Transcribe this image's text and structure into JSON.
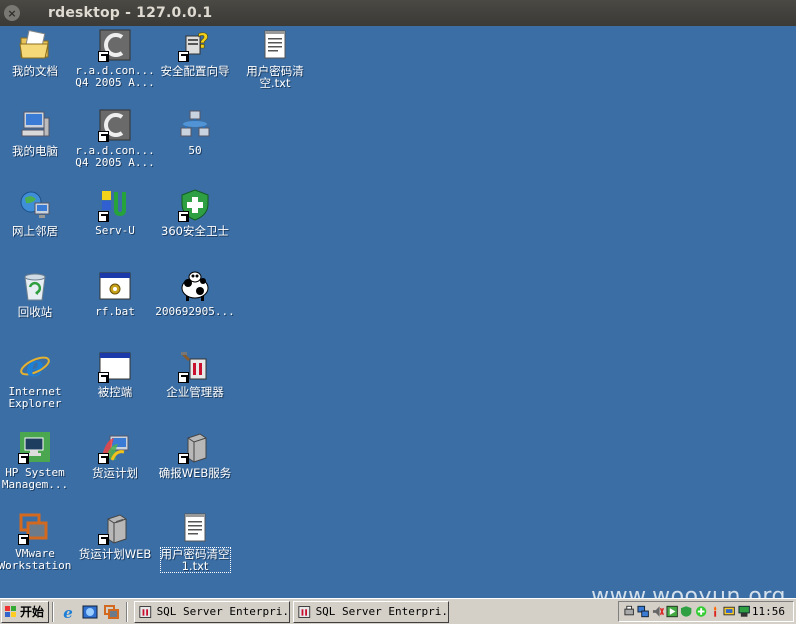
{
  "window": {
    "title": "rdesktop - 127.0.0.1",
    "close_glyph": "×"
  },
  "desktop": {
    "watermark": "www.wooyun.org",
    "icons": [
      {
        "label": "我的文档",
        "icon": "my-documents-icon"
      },
      {
        "label": "r.a.d.con...\nQ4 2005 A...",
        "icon": "radcontrols-icon"
      },
      {
        "label": "安全配置向导",
        "icon": "security-wizard-icon"
      },
      {
        "label": "用户密码清\n空.txt",
        "icon": "text-file-icon"
      },
      {
        "label": "我的电脑",
        "icon": "my-computer-icon"
      },
      {
        "label": "r.a.d.con...\nQ4 2005 A...",
        "icon": "radcontrols-icon"
      },
      {
        "label": "50",
        "icon": "network-icon"
      },
      {
        "label": "网上邻居",
        "icon": "network-places-icon"
      },
      {
        "label": "Serv-U",
        "icon": "servu-icon"
      },
      {
        "label": "360安全卫士",
        "icon": "shield-plus-icon"
      },
      {
        "label": "回收站",
        "icon": "recycle-bin-icon"
      },
      {
        "label": "rf.bat",
        "icon": "batch-file-icon"
      },
      {
        "label": "200692905...",
        "icon": "cow-image-icon"
      },
      {
        "label": "Internet\nExplorer",
        "icon": "internet-explorer-icon"
      },
      {
        "label": "被控端",
        "icon": "window-app-icon"
      },
      {
        "label": "企业管理器",
        "icon": "enterprise-manager-icon"
      },
      {
        "label": "HP System\nManagem...",
        "icon": "hp-system-icon"
      },
      {
        "label": "货运计划",
        "icon": "freight-plan-icon"
      },
      {
        "label": "确报WEB服务",
        "icon": "server-icon"
      },
      {
        "label": "VMware\nWorkstation",
        "icon": "vmware-icon"
      },
      {
        "label": "货运计划WEB",
        "icon": "server-icon"
      },
      {
        "label": "用户密码清空\n1.txt",
        "icon": "text-file-icon"
      }
    ]
  },
  "taskbar": {
    "start_label": "开始",
    "quick_launch": [
      "ie-icon",
      "outlook-icon",
      "vmware-icon"
    ],
    "tasks": [
      {
        "label": "SQL Server Enterpri..."
      },
      {
        "label": "SQL Server Enterpri..."
      }
    ],
    "clock": "11:56",
    "tray_icons": [
      "printer-icon",
      "network-icon",
      "volume-icon",
      "media-icon",
      "shield-icon",
      "plus-icon",
      "torch-icon",
      "monitor-icon",
      "flag-icon"
    ]
  },
  "colors": {
    "desktop": "#3a6ea5",
    "taskbar": "#d4d0c8",
    "titlebar": "#3b3a36"
  }
}
